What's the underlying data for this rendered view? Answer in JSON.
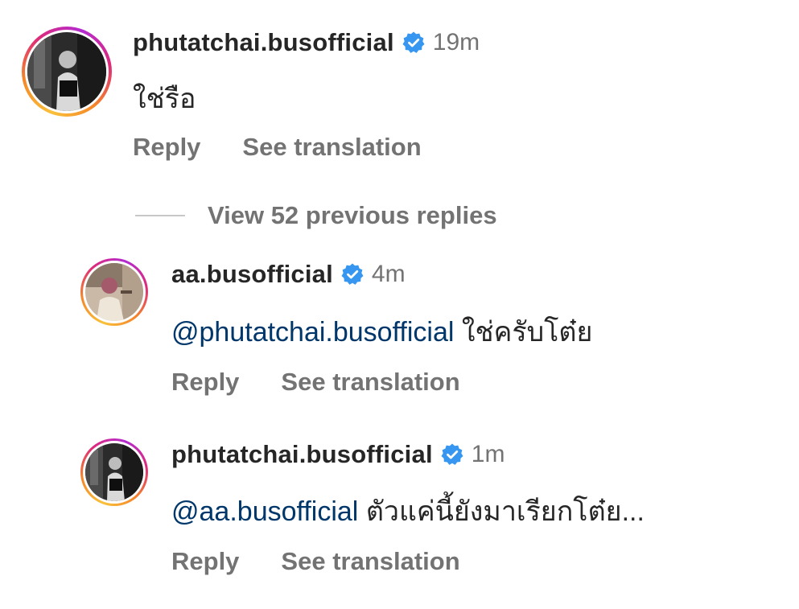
{
  "colors": {
    "username": "#262626",
    "secondary_text": "#737373",
    "mention": "#00376b",
    "verified_badge": "#3797f0"
  },
  "comments": [
    {
      "username": "phutatchai.busofficial",
      "verified": true,
      "time": "19m",
      "mention": "",
      "text": "ใช่รือ",
      "reply_label": "Reply",
      "translate_label": "See translation"
    },
    {
      "username": "aa.busofficial",
      "verified": true,
      "time": "4m",
      "mention": "@phutatchai.busofficial",
      "text": "ใช่ครับโต๋ย",
      "reply_label": "Reply",
      "translate_label": "See translation"
    },
    {
      "username": "phutatchai.busofficial",
      "verified": true,
      "time": "1m",
      "mention": "@aa.busofficial",
      "text": "ตัวแค่นี้ยังมาเรียกโต๋ย...",
      "reply_label": "Reply",
      "translate_label": "See translation"
    }
  ],
  "view_replies": {
    "label": "View 52 previous replies"
  }
}
